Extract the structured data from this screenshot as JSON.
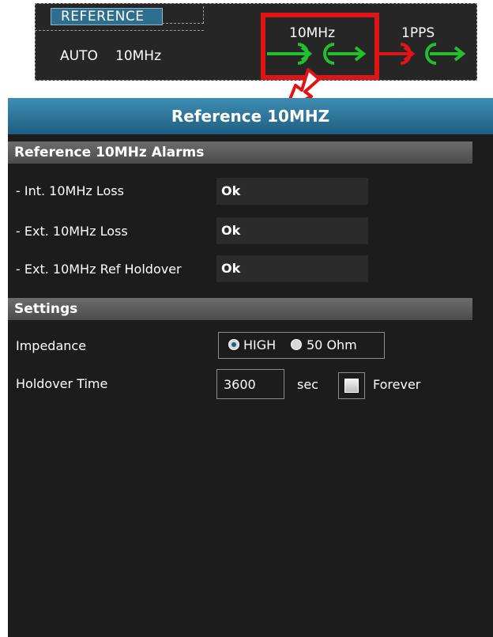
{
  "reference_strip": {
    "tab_label": "REFERENCE",
    "mode": "AUTO",
    "frequency": "10MHz",
    "signal_10mhz_label": "10MHz",
    "signal_1pps_label": "1PPS",
    "status_colors": {
      "ok": "#22c02a",
      "alarm": "#e01414"
    }
  },
  "panel": {
    "title": "Reference 10MHZ",
    "alarms": {
      "section_title": "Reference 10MHz Alarms",
      "rows": [
        {
          "label": "- Int. 10MHz Loss",
          "value": "Ok"
        },
        {
          "label": "- Ext. 10MHz Loss",
          "value": "Ok"
        },
        {
          "label": "- Ext. 10MHz Ref Holdover",
          "value": "Ok"
        }
      ]
    },
    "settings": {
      "section_title": "Settings",
      "impedance_label": "Impedance",
      "impedance_options": [
        "HIGH",
        "50 Ohm"
      ],
      "impedance_selected": "HIGH",
      "holdover_label": "Holdover Time",
      "holdover_value": "3600",
      "holdover_unit": "sec",
      "forever_label": "Forever",
      "forever_checked": false
    }
  },
  "colors": {
    "header": "#2e7aa0",
    "panel_bg": "#1c1c1c",
    "highlight": "#e01414"
  }
}
